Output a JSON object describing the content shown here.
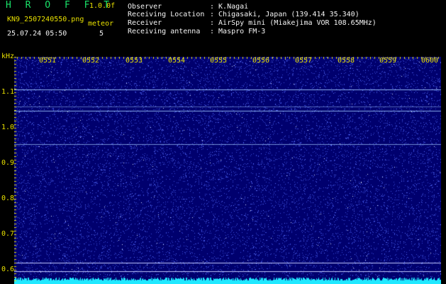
{
  "header": {
    "app_title": "H R O F F T",
    "version": "1.0.0f",
    "filename": "KN9_2507240550.png",
    "datetime": "25.07.24 05:50",
    "meteor_label": "meteor",
    "meteor_count": "5",
    "info": [
      {
        "label": "Observer",
        "value": ": K.Nagai"
      },
      {
        "label": "Receiving Location",
        "value": ": Chigasaki, Japan (139.414 35.340)"
      },
      {
        "label": "Receiver",
        "value": ": AirSpy mini (Miakejima VOR 108.65MHz)"
      },
      {
        "label": "Receiving antenna",
        "value": ": Maspro FM-3"
      }
    ]
  },
  "axes": {
    "y_unit": "kHz",
    "x_ticks": [
      "0551",
      "0552",
      "0553",
      "0554",
      "0555",
      "0556",
      "0557",
      "0558",
      "0559",
      "0600"
    ],
    "y_ticks": [
      "1.1",
      "1.0",
      "0.9",
      "0.8",
      "0.7",
      "0.6"
    ]
  },
  "colors": {
    "background": "#00006e",
    "noise": "#3a4bd8",
    "signal_line": "#9fc8ff",
    "baseline": "#20e8ff",
    "ticks": "#e8e000"
  }
}
